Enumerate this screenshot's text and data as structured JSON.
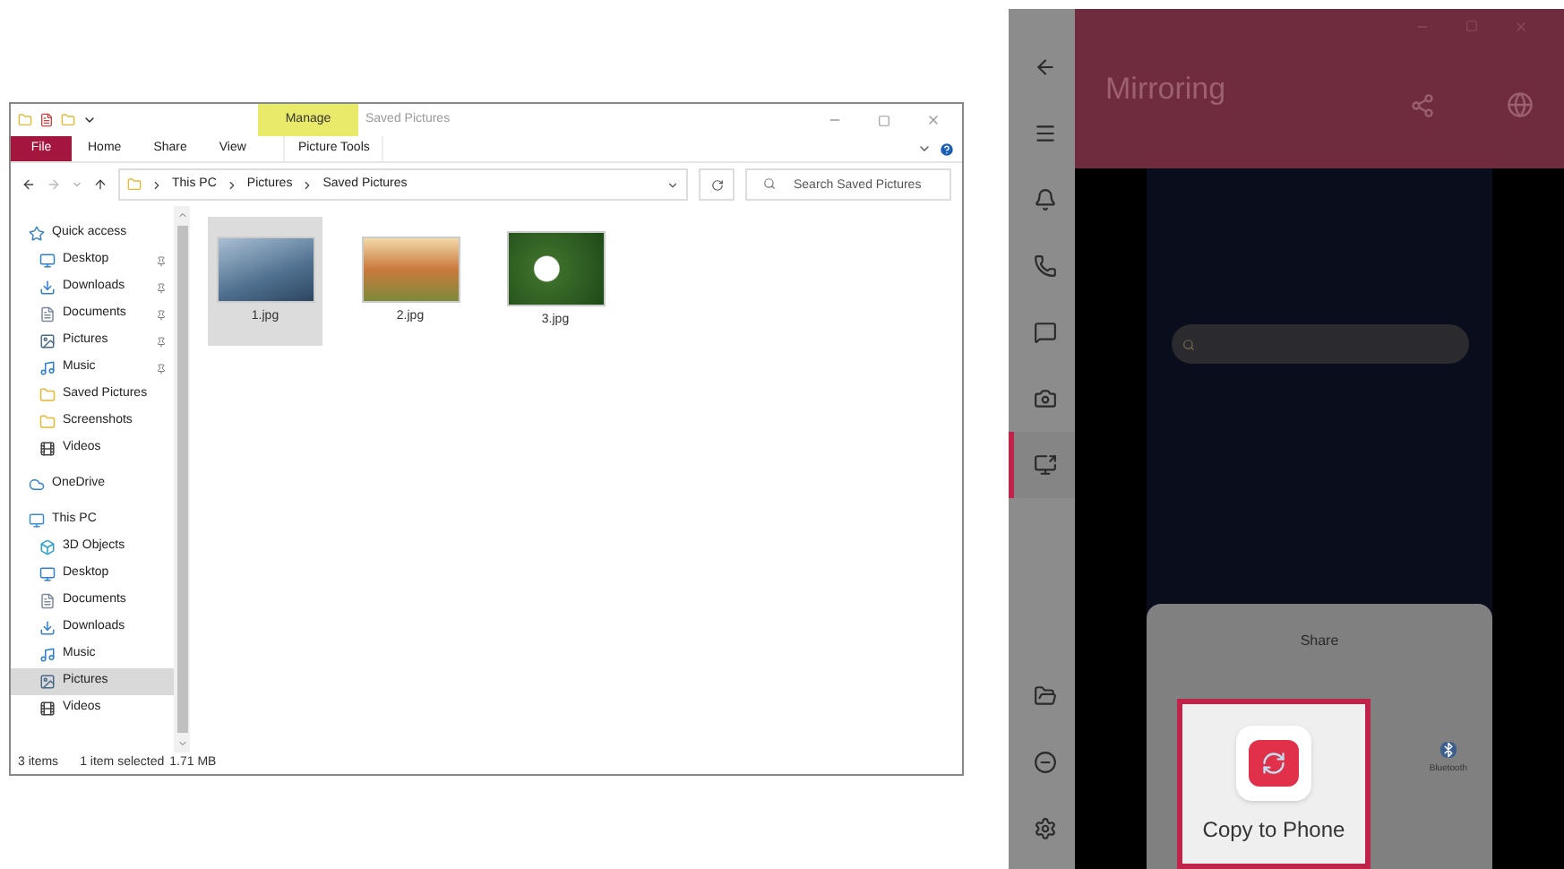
{
  "explorer": {
    "title": "Saved Pictures",
    "context_tab": "Manage",
    "ribbon_tabs": [
      {
        "label": "File",
        "kind": "file"
      },
      {
        "label": "Home",
        "kind": "plain"
      },
      {
        "label": "Share",
        "kind": "plain"
      },
      {
        "label": "View",
        "kind": "plain"
      },
      {
        "label": "Picture Tools",
        "kind": "context"
      }
    ],
    "breadcrumb": [
      "This PC",
      "Pictures",
      "Saved Pictures"
    ],
    "search": {
      "placeholder": "Search Saved Pictures"
    },
    "nav": [
      {
        "label": "Quick access",
        "kind": "star",
        "selected": false,
        "children": [
          {
            "label": "Desktop",
            "kind": "desktop",
            "pinned": true,
            "selected": false
          },
          {
            "label": "Downloads",
            "kind": "download",
            "pinned": true,
            "selected": false
          },
          {
            "label": "Documents",
            "kind": "document",
            "pinned": true,
            "selected": false
          },
          {
            "label": "Pictures",
            "kind": "picture",
            "pinned": true,
            "selected": false
          },
          {
            "label": "Music",
            "kind": "music",
            "pinned": true,
            "selected": false
          },
          {
            "label": "Saved Pictures",
            "kind": "folder",
            "pinned": false,
            "selected": false
          },
          {
            "label": "Screenshots",
            "kind": "folder",
            "pinned": false,
            "selected": false
          },
          {
            "label": "Videos",
            "kind": "video",
            "pinned": false,
            "selected": false
          }
        ]
      },
      {
        "label": "OneDrive",
        "kind": "cloud",
        "selected": false
      },
      {
        "label": "This PC",
        "kind": "pc",
        "selected": false,
        "children": [
          {
            "label": "3D Objects",
            "kind": "cube",
            "pinned": false,
            "selected": false
          },
          {
            "label": "Desktop",
            "kind": "desktop",
            "pinned": false,
            "selected": false
          },
          {
            "label": "Documents",
            "kind": "document",
            "pinned": false,
            "selected": false
          },
          {
            "label": "Downloads",
            "kind": "download",
            "pinned": false,
            "selected": false
          },
          {
            "label": "Music",
            "kind": "music",
            "pinned": false,
            "selected": false
          },
          {
            "label": "Pictures",
            "kind": "picture",
            "pinned": false,
            "selected": true
          },
          {
            "label": "Videos",
            "kind": "video",
            "pinned": false,
            "selected": false
          }
        ]
      }
    ],
    "files": [
      {
        "name": "1.jpg",
        "kind": "mountain",
        "selected": true
      },
      {
        "name": "2.jpg",
        "kind": "field",
        "selected": false
      },
      {
        "name": "3.jpg",
        "kind": "flowers",
        "selected": false
      }
    ],
    "status_bar": [
      "3 items",
      "1 item selected",
      "1.71 MB"
    ]
  },
  "mirroring": {
    "title": "Mirroring",
    "rail": [
      {
        "kind": "back",
        "selected": false
      },
      {
        "kind": "menu",
        "selected": false
      },
      {
        "kind": "bell",
        "selected": false
      },
      {
        "kind": "phone",
        "selected": false
      },
      {
        "kind": "message",
        "selected": false
      },
      {
        "kind": "camera",
        "selected": false
      },
      {
        "kind": "screen",
        "selected": true
      },
      {
        "kind": "folder",
        "selected": false
      },
      {
        "kind": "minus",
        "selected": false
      },
      {
        "kind": "settings",
        "selected": false
      }
    ],
    "share_sheet": {
      "title": "Share",
      "bluetooth_label": "Bluetooth"
    },
    "callout": {
      "label": "Copy to Phone"
    }
  }
}
